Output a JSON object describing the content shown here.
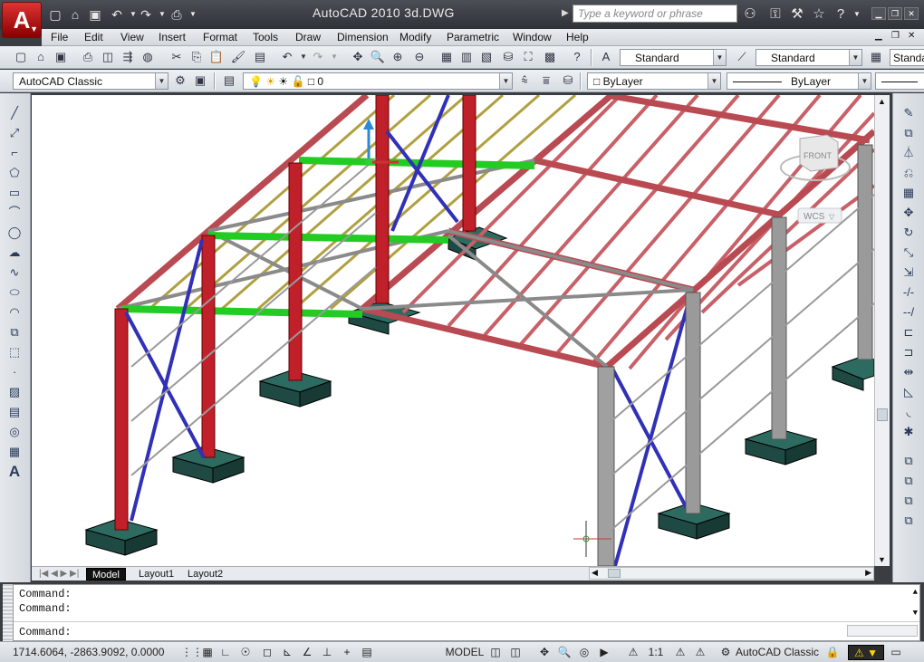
{
  "app": {
    "title": "AutoCAD 2010     3d.DWG",
    "logo_letter": "A",
    "search_placeholder": "Type a keyword or phrase"
  },
  "menu": [
    "File",
    "Edit",
    "View",
    "Insert",
    "Format",
    "Tools",
    "Draw",
    "Dimension",
    "Modify",
    "Parametric",
    "Window",
    "Help"
  ],
  "toolbar": {
    "text_style": "Standard",
    "dim_style": "Standard",
    "table_style": "Standa"
  },
  "properties": {
    "workspace": "AutoCAD Classic",
    "layer": "0",
    "color": "ByLayer",
    "linetype": "ByLayer"
  },
  "viewcube": {
    "face": "FRONT",
    "ucs": "WCS"
  },
  "layout_tabs": [
    "Model",
    "Layout1",
    "Layout2"
  ],
  "command_lines": [
    "Command:",
    "Command:",
    "Command:"
  ],
  "status": {
    "coords": "1714.6064, -2863.9092, 0.0000",
    "space": "MODEL",
    "scale": "1:1",
    "workspace": "AutoCAD Classic"
  },
  "colors": {
    "steel_red": "#c0202a",
    "selected_green": "#22cc22",
    "brace_blue": "#3030b8",
    "footing": "#1f4a44",
    "column_gray": "#9a9a9a"
  }
}
